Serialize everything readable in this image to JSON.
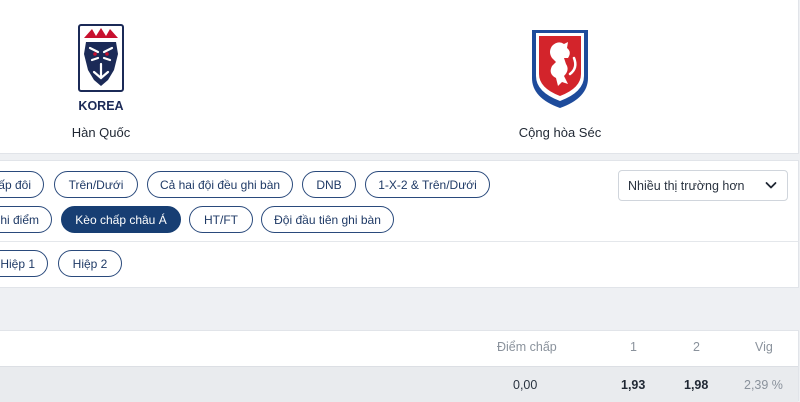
{
  "match": {
    "home": {
      "name": "Hàn Quốc",
      "logo_text": "KOREA"
    },
    "away": {
      "name": "Cộng hòa Séc"
    }
  },
  "markets": {
    "row1": [
      "ấp đôi",
      "Trên/Dưới",
      "Cả hai đội đều ghi bàn",
      "DNB",
      "1-X-2 & Trên/Dưới"
    ],
    "row2": [
      "hi điểm",
      "Kèo chấp châu Á",
      "HT/FT",
      "Đội đầu tiên ghi bàn"
    ],
    "active": "Kèo chấp châu Á",
    "more_select": "Nhiều thị trường hơn"
  },
  "periods": [
    "Hiệp 1",
    "Hiệp 2"
  ],
  "odds_table": {
    "headers": [
      "Điểm chấp",
      "1",
      "2",
      "Vig"
    ],
    "rows": [
      {
        "handicap": "0,00",
        "home": "1,93",
        "away": "1,98",
        "vig": "2,39 %"
      }
    ]
  },
  "colors": {
    "accent": "#173e73",
    "pill_border": "#2a4a7c",
    "korea_red": "#c8102e",
    "korea_navy": "#1b2a57",
    "czech_red": "#d3242b",
    "czech_blue": "#1e4b9b"
  },
  "icons": {
    "home_logo": "korea-tiger-crest-icon",
    "away_logo": "czech-lion-crest-icon",
    "select_arrow": "chevron-down-icon"
  }
}
